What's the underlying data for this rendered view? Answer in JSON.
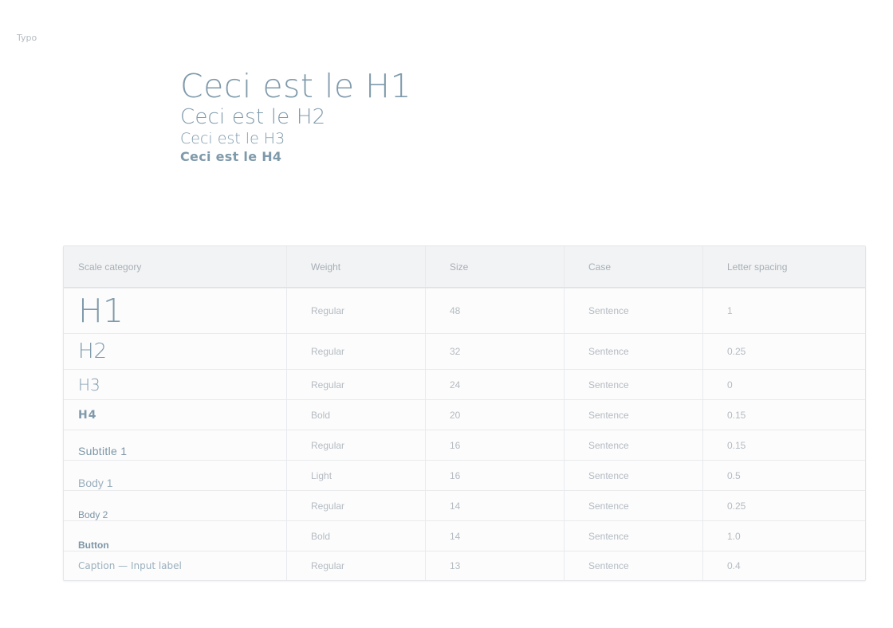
{
  "frame_label": "Typo",
  "headings": {
    "h1": "Ceci est le H1",
    "h2": "Ceci est le H2",
    "h3": "Ceci est le H3",
    "h4": "Ceci est le H4"
  },
  "table": {
    "columns": [
      "Scale category",
      "Weight",
      "Size",
      "Case",
      "Letter spacing"
    ],
    "rows": [
      {
        "category": "H1",
        "weight": "Regular",
        "size": "48",
        "case": "Sentence",
        "spacing": "1"
      },
      {
        "category": "H2",
        "weight": "Regular",
        "size": "32",
        "case": "Sentence",
        "spacing": "0.25"
      },
      {
        "category": "H3",
        "weight": "Regular",
        "size": "24",
        "case": "Sentence",
        "spacing": "0"
      },
      {
        "category": "H4",
        "weight": "Bold",
        "size": "20",
        "case": "Sentence",
        "spacing": "0.15"
      },
      {
        "category": "Subtitle 1",
        "weight": "Regular",
        "size": "16",
        "case": "Sentence",
        "spacing": "0.15"
      },
      {
        "category": "Body 1",
        "weight": "Light",
        "size": "16",
        "case": "Sentence",
        "spacing": "0.5"
      },
      {
        "category": "Body 2",
        "weight": "Regular",
        "size": "14",
        "case": "Sentence",
        "spacing": "0.25"
      },
      {
        "category": "Button",
        "weight": "Bold",
        "size": "14",
        "case": "Sentence",
        "spacing": "1.0"
      },
      {
        "category": "Caption — Input label",
        "weight": "Regular",
        "size": "13",
        "case": "Sentence",
        "spacing": "0.4"
      }
    ]
  },
  "colors": {
    "heading": "#7f9aab",
    "muted_text": "#b4bbc2",
    "header_bg": "#f2f3f4",
    "border": "#e8eaed"
  }
}
